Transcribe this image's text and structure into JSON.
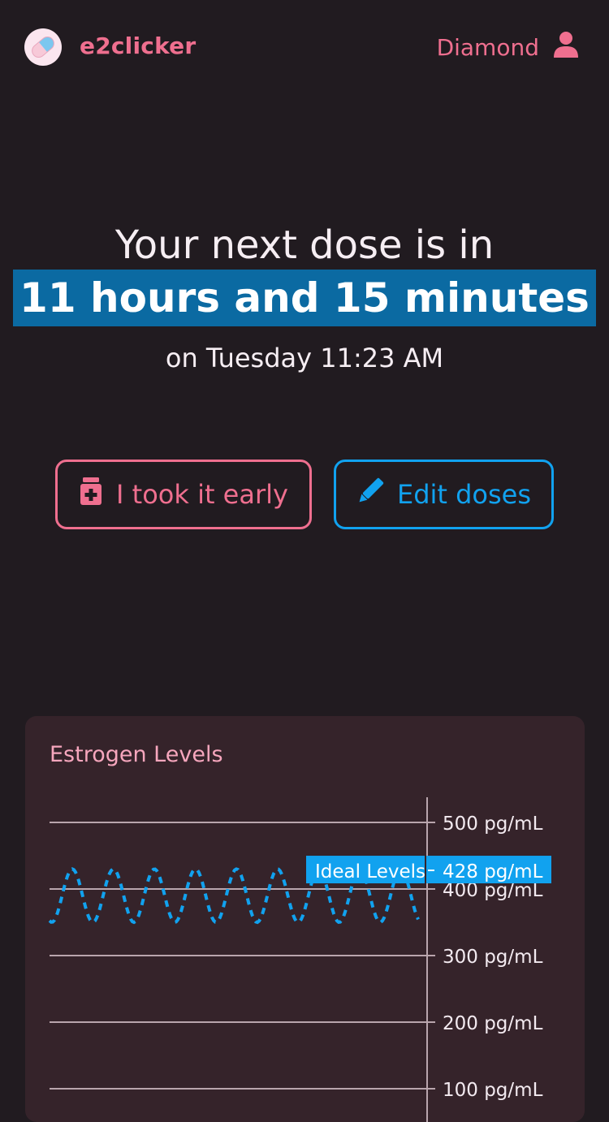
{
  "header": {
    "app_name": "e2clicker",
    "user_name": "Diamond",
    "logo_icon": "pill-icon",
    "user_icon": "user-icon"
  },
  "hero": {
    "line1": "Your next dose is in",
    "countdown": "11 hours and 15 minutes",
    "next_time": "on Tuesday 11:23 AM"
  },
  "actions": {
    "took_early_label": "I took it early",
    "took_early_icon": "medicine-bottle-icon",
    "edit_doses_label": "Edit doses",
    "edit_doses_icon": "pencil-icon"
  },
  "colors": {
    "background": "#211b20",
    "accent_pink": "#ef6f8f",
    "accent_blue": "#11a2ef",
    "highlight_blue": "#0b6aa2",
    "card": "#35232a"
  },
  "chart_card": {
    "title": "Estrogen Levels"
  },
  "chart_data": {
    "type": "line",
    "title": "Estrogen Levels",
    "y_unit": "pg/mL",
    "y_ticks": [
      500,
      400,
      300,
      200,
      100
    ],
    "y_tick_labels": [
      "500 pg/mL",
      "400 pg/mL",
      "300 pg/mL",
      "200 pg/mL",
      "100 pg/mL"
    ],
    "ylim": [
      100,
      540
    ],
    "grid": true,
    "annotation": {
      "label": "Ideal Levels",
      "value": 428,
      "value_label": "428 pg/mL"
    },
    "series": [
      {
        "style": "dashed",
        "color": "#11a2ef",
        "cycles": 9,
        "peak": 430,
        "trough": 350
      }
    ]
  }
}
